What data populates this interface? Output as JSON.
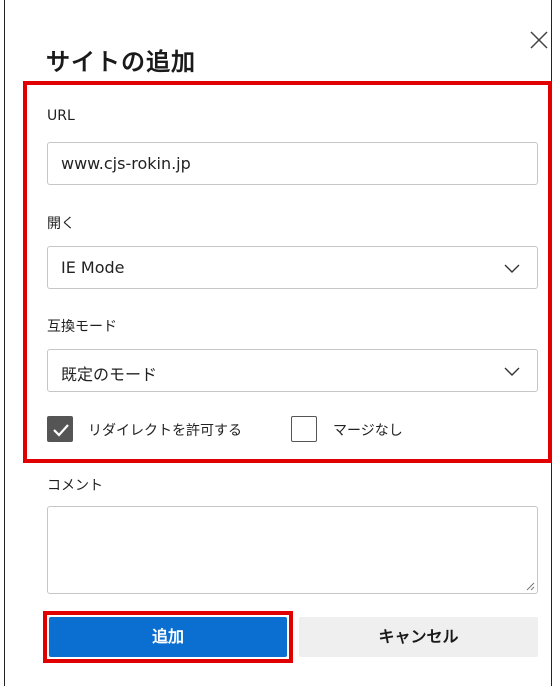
{
  "dialog": {
    "title": "サイトの追加",
    "close_icon": "close-icon"
  },
  "url": {
    "label": "URL",
    "value": "www.cjs-rokin.jp"
  },
  "open": {
    "label": "開く",
    "selected": "IE Mode",
    "icon": "chevron-down-icon"
  },
  "compat_mode": {
    "label": "互換モード",
    "selected": "既定のモード",
    "icon": "chevron-down-icon"
  },
  "options": {
    "allow_redirect": {
      "label": "リダイレクトを許可する",
      "checked": true
    },
    "no_merge": {
      "label": "マージなし",
      "checked": false
    }
  },
  "comment": {
    "label": "コメント",
    "value": ""
  },
  "buttons": {
    "add_label": "追加",
    "cancel_label": "キャンセル"
  },
  "colors": {
    "highlight": "#e00000",
    "primary": "#0a6fd1",
    "secondary": "#efefef"
  }
}
